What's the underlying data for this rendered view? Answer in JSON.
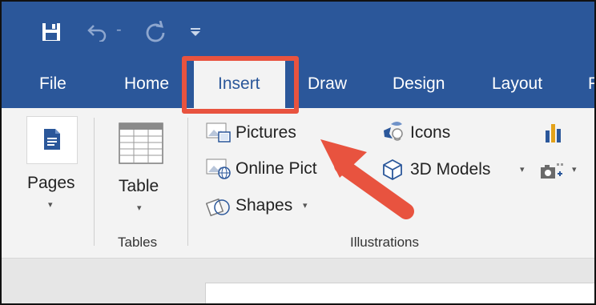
{
  "quick_access": {
    "icons": [
      "save-icon",
      "undo-icon",
      "redo-icon",
      "customize-qat-icon"
    ],
    "undo_dropdown": "-"
  },
  "tabs": [
    {
      "label": "File"
    },
    {
      "label": "Home"
    },
    {
      "label": "Insert",
      "active": true
    },
    {
      "label": "Draw"
    },
    {
      "label": "Design"
    },
    {
      "label": "Layout"
    },
    {
      "label": "R"
    }
  ],
  "ribbon": {
    "pages": {
      "label": "Pages",
      "dropdown": "▾"
    },
    "tables": {
      "button_label": "Table",
      "dropdown": "▾",
      "group_label": "Tables"
    },
    "illustrations": {
      "pictures": "Pictures",
      "online_pictures": "Online Pict",
      "shapes": "Shapes",
      "shapes_dropdown": "▾",
      "icons": "Icons",
      "models_3d": "3D Models",
      "models_3d_dropdown": "▾",
      "screenshot_dropdown": "▾",
      "group_label": "Illustrations"
    }
  },
  "annotation": {
    "highlight_color": "#e8533f",
    "target": "tab-insert",
    "arrow_points_to": "pictures-button"
  },
  "colors": {
    "accent": "#2b579a",
    "ribbon_bg": "#f3f3f3",
    "annotation": "#e8533f"
  }
}
